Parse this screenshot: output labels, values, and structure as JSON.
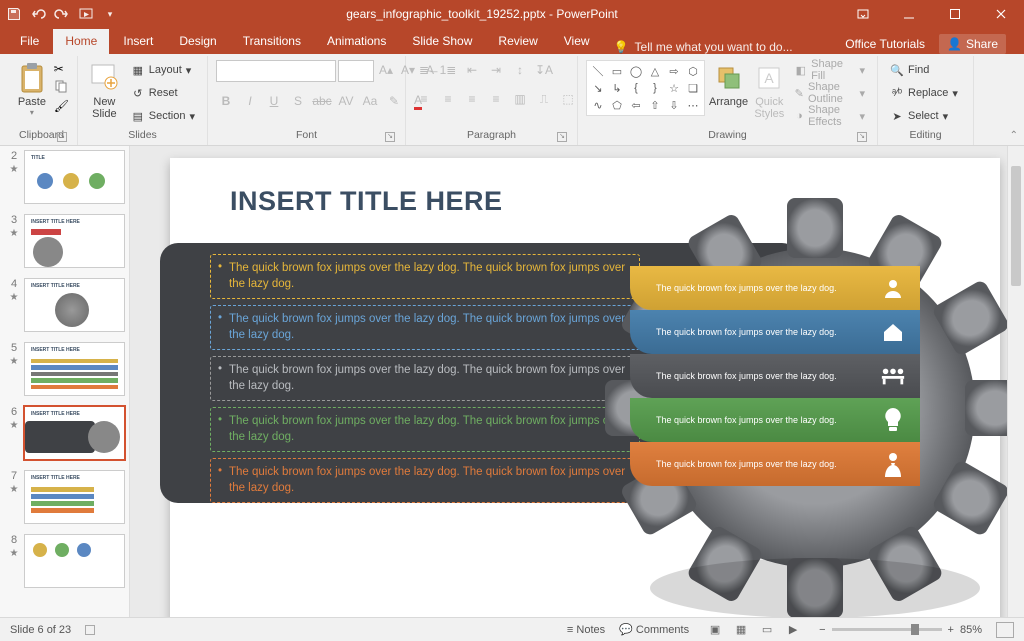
{
  "app": {
    "filename": "gears_infographic_toolkit_19252.pptx",
    "appname": "PowerPoint"
  },
  "tabs": {
    "file": "File",
    "list": [
      "Home",
      "Insert",
      "Design",
      "Transitions",
      "Animations",
      "Slide Show",
      "Review",
      "View"
    ],
    "active_index": 0,
    "tellme": "Tell me what you want to do...",
    "right": {
      "tutorials": "Office Tutorials",
      "share": "Share"
    }
  },
  "ribbon": {
    "clipboard": {
      "label": "Clipboard",
      "paste": "Paste"
    },
    "slides": {
      "label": "Slides",
      "newslide": "New\nSlide",
      "layout": "Layout",
      "reset": "Reset",
      "section": "Section"
    },
    "font": {
      "label": "Font"
    },
    "paragraph": {
      "label": "Paragraph"
    },
    "drawing": {
      "label": "Drawing",
      "arrange": "Arrange",
      "quick": "Quick\nStyles",
      "fill": "Shape Fill",
      "outline": "Shape Outline",
      "effects": "Shape Effects"
    },
    "editing": {
      "label": "Editing",
      "find": "Find",
      "replace": "Replace",
      "select": "Select"
    }
  },
  "thumbs": {
    "items": [
      {
        "n": "2"
      },
      {
        "n": "3"
      },
      {
        "n": "4"
      },
      {
        "n": "5"
      },
      {
        "n": "6",
        "sel": true
      },
      {
        "n": "7"
      },
      {
        "n": "8"
      }
    ]
  },
  "slide": {
    "title": "INSERT TITLE HERE",
    "bullet": "The quick brown fox jumps over the lazy dog. The quick brown fox jumps over the lazy dog.",
    "gear_rows": [
      {
        "text": "The quick brown fox jumps over the lazy dog."
      },
      {
        "text": "The quick brown fox jumps over the lazy dog."
      },
      {
        "text": "The quick brown fox jumps over the lazy dog."
      },
      {
        "text": "The quick brown fox jumps over the lazy dog."
      },
      {
        "text": "The quick brown fox jumps over the lazy dog."
      }
    ]
  },
  "status": {
    "slide": "Slide 6 of 23",
    "lang": "",
    "notes": "Notes",
    "comments": "Comments",
    "zoom": "85%"
  }
}
